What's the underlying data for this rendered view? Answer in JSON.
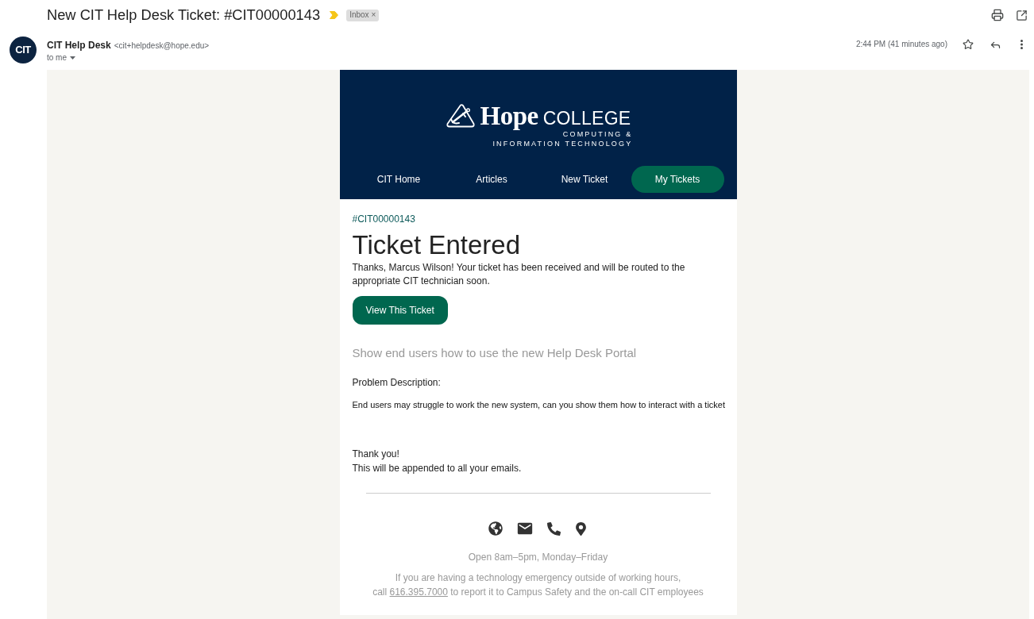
{
  "message": {
    "subject": "New CIT Help Desk Ticket: #CIT00000143",
    "important": true,
    "labels": [
      {
        "text": "Inbox",
        "close": "×"
      }
    ]
  },
  "sender": {
    "avatar": "CIT",
    "name": "CIT Help Desk",
    "address": "<cit+helpdesk@hope.edu>",
    "recipient": "to me",
    "time": "2:44 PM (41 minutes ago)",
    "starred": false
  },
  "body": {
    "logo": {
      "name": "Hope",
      "suffix": "COLLEGE",
      "department": [
        "COMPUTING &",
        "INFORMATION TECHNOLOGY"
      ]
    },
    "nav": [
      {
        "label": "CIT Home",
        "selected": false
      },
      {
        "label": "Articles",
        "selected": false
      },
      {
        "label": "New Ticket",
        "selected": false
      },
      {
        "label": "My Tickets",
        "selected": true
      }
    ],
    "ticket_id": "#CIT00000143",
    "heading": "Ticket Entered",
    "message": "Thanks, Marcus Wilson! Your ticket has been received and will be routed to the appropriate CIT technician soon.",
    "button": "View This Ticket",
    "ticket_title": "Show end users how to use the new Help Desk Portal",
    "description_label": "Problem Description:",
    "description": "End users may struggle to work the new system, can you show them how to interact with a ticket",
    "signature": [
      "Thank you!",
      "This will be appended to all your emails."
    ],
    "footer": {
      "hours": "Open 8am–5pm, Monday–Friday",
      "emergency": {
        "line_1": "If you are having a technology emergency outside of working hours,",
        "before_phone": "call",
        "phone": "616.395.7000",
        "after_phone": "to report it to Campus Safety and the on-call CIT employees"
      }
    }
  }
}
